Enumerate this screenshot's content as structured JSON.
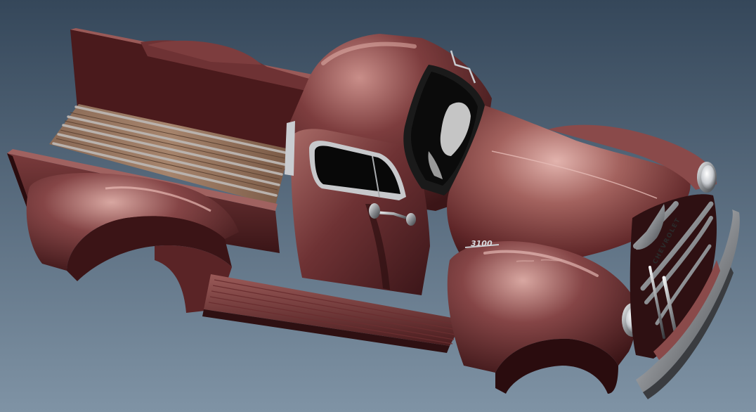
{
  "scene": {
    "subject": "pickup-truck-3d-model",
    "colors": {
      "background_top": "#35475a",
      "background_bottom": "#7f93a5",
      "body_base": "#5a2628",
      "body_mid": "#8a4a4a",
      "body_highlight": "#d9a6a1",
      "body_dark": "#2e1012",
      "wood": "#7a5a44",
      "wood_light": "#a0806a",
      "chrome": "#c9ccd0",
      "chrome_dark": "#4a4c50",
      "glass": "#0a0a0a"
    }
  },
  "emblems": {
    "fender_badge": "3100",
    "grille_badge": "CHEVROLET"
  }
}
